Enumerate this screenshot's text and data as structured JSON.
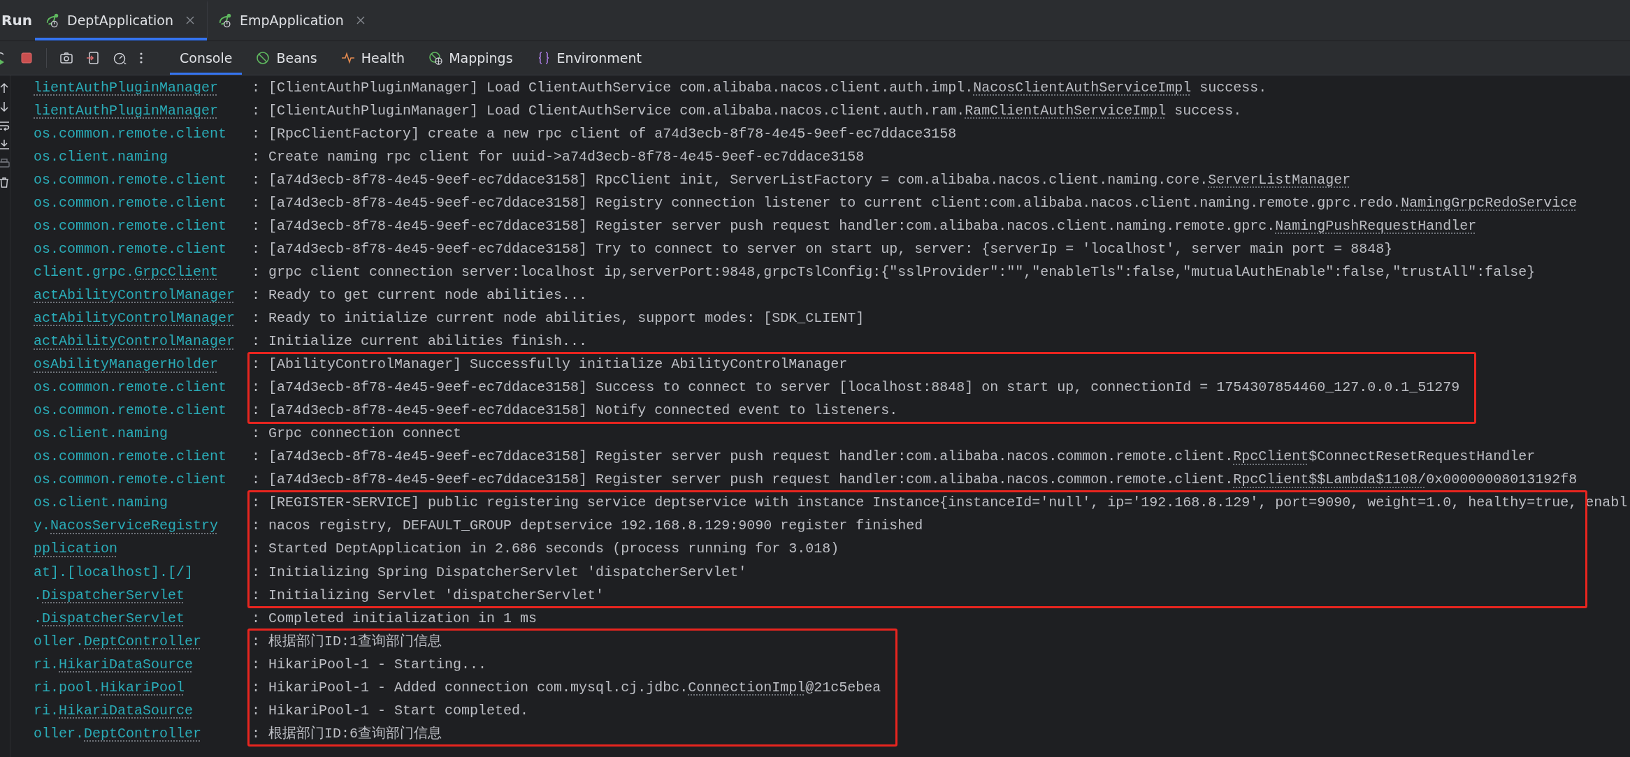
{
  "tool_window": {
    "title": "Run"
  },
  "run_tabs": [
    {
      "label": "DeptApplication",
      "selected": true
    },
    {
      "label": "EmpApplication",
      "selected": false
    }
  ],
  "view_tabs": [
    {
      "label": "Console",
      "selected": true,
      "kind": "console"
    },
    {
      "label": "Beans",
      "selected": false,
      "kind": "beans"
    },
    {
      "label": "Health",
      "selected": false,
      "kind": "health"
    },
    {
      "label": "Mappings",
      "selected": false,
      "kind": "mappings"
    },
    {
      "label": "Environment",
      "selected": false,
      "kind": "environment"
    }
  ],
  "log": {
    "separator": ":",
    "groups": [
      {
        "highlighted": false,
        "lines": [
          {
            "logger": [
              {
                "link": "lientAuthPluginManager"
              }
            ],
            "message": [
              "[ClientAuthPluginManager] Load ClientAuthService com.alibaba.nacos.client.auth.impl.",
              {
                "link": "NacosClientAuthServiceImpl"
              },
              " success."
            ]
          },
          {
            "logger": [
              {
                "link": "lientAuthPluginManager"
              }
            ],
            "message": [
              "[ClientAuthPluginManager] Load ClientAuthService com.alibaba.nacos.client.auth.ram.",
              {
                "link": "RamClientAuthServiceImpl"
              },
              " success."
            ]
          },
          {
            "logger": [
              "os.common.remote.client"
            ],
            "message": [
              "[RpcClientFactory] create a new rpc client of a74d3ecb-8f78-4e45-9eef-ec7ddace3158"
            ]
          },
          {
            "logger": [
              "os.client.naming"
            ],
            "message": [
              "Create naming rpc client for uuid->a74d3ecb-8f78-4e45-9eef-ec7ddace3158"
            ]
          },
          {
            "logger": [
              "os.common.remote.client"
            ],
            "message": [
              "[a74d3ecb-8f78-4e45-9eef-ec7ddace3158] RpcClient init, ServerListFactory = com.alibaba.nacos.client.naming.core.",
              {
                "link": "ServerListManager"
              }
            ]
          },
          {
            "logger": [
              "os.common.remote.client"
            ],
            "message": [
              "[a74d3ecb-8f78-4e45-9eef-ec7ddace3158] Registry connection listener to current client:com.alibaba.nacos.client.naming.remote.gprc.redo.",
              {
                "link": "NamingGrpcRedoService"
              }
            ]
          },
          {
            "logger": [
              "os.common.remote.client"
            ],
            "message": [
              "[a74d3ecb-8f78-4e45-9eef-ec7ddace3158] Register server push request handler:com.alibaba.nacos.client.naming.remote.gprc.",
              {
                "link": "NamingPushRequestHandler"
              }
            ]
          },
          {
            "logger": [
              "os.common.remote.client"
            ],
            "message": [
              "[a74d3ecb-8f78-4e45-9eef-ec7ddace3158] Try to connect to server on start up, server: {serverIp = 'localhost', server main port = 8848}"
            ]
          },
          {
            "logger": [
              "client.grpc.",
              {
                "link": "GrpcClient"
              }
            ],
            "message": [
              "grpc client connection server:localhost ip,serverPort:9848,grpcTslConfig:{\"sslProvider\":\"\",\"enableTls\":false,\"mutualAuthEnable\":false,\"trustAll\":false}"
            ]
          },
          {
            "logger": [
              {
                "link": "actAbilityControlManager"
              }
            ],
            "message": [
              "Ready to get current node abilities..."
            ]
          },
          {
            "logger": [
              {
                "link": "actAbilityControlManager"
              }
            ],
            "message": [
              "Ready to initialize current node abilities, support modes: [SDK_CLIENT]"
            ]
          },
          {
            "logger": [
              {
                "link": "actAbilityControlManager"
              }
            ],
            "message": [
              "Initialize current abilities finish..."
            ]
          }
        ]
      },
      {
        "highlighted": true,
        "lines": [
          {
            "logger": [
              {
                "link": "osAbilityManagerHolder"
              }
            ],
            "message": [
              "[AbilityControlManager] Successfully initialize AbilityControlManager"
            ]
          },
          {
            "logger": [
              "os.common.remote.client"
            ],
            "message": [
              "[a74d3ecb-8f78-4e45-9eef-ec7ddace3158] Success to connect to server [localhost:8848] on start up, connectionId = 1754307854460_127.0.0.1_51279"
            ]
          },
          {
            "logger": [
              "os.common.remote.client"
            ],
            "message": [
              "[a74d3ecb-8f78-4e45-9eef-ec7ddace3158] Notify connected event to listeners."
            ]
          }
        ]
      },
      {
        "highlighted": false,
        "lines": [
          {
            "logger": [
              "os.client.naming"
            ],
            "message": [
              "Grpc connection connect"
            ]
          },
          {
            "logger": [
              "os.common.remote.client"
            ],
            "message": [
              "[a74d3ecb-8f78-4e45-9eef-ec7ddace3158] Register server push request handler:com.alibaba.nacos.common.remote.client.",
              {
                "link": "RpcClient"
              },
              "$ConnectResetRequestHandler"
            ]
          },
          {
            "logger": [
              "os.common.remote.client"
            ],
            "message": [
              "[a74d3ecb-8f78-4e45-9eef-ec7ddace3158] Register server push request handler:com.alibaba.nacos.common.remote.client.",
              {
                "link": "RpcClient$$Lambda$1108/"
              },
              "0x00000008013192f8"
            ]
          }
        ]
      },
      {
        "highlighted": true,
        "lines": [
          {
            "logger": [
              "os.client.naming"
            ],
            "message": [
              "[REGISTER-SERVICE] public registering service deptservice with instance Instance{instanceId='null', ip='192.168.8.129', port=9090, weight=1.0, healthy=true, enabl"
            ]
          },
          {
            "logger": [
              "y.",
              {
                "link": "NacosServiceRegistry"
              }
            ],
            "message": [
              "nacos registry, DEFAULT_GROUP deptservice 192.168.8.129:9090 register finished"
            ]
          },
          {
            "logger": [
              {
                "link": "pplication"
              }
            ],
            "message": [
              "Started DeptApplication in 2.686 seconds (process running for 3.018)"
            ]
          },
          {
            "logger": [
              "at].[localhost].[/]"
            ],
            "message": [
              "Initializing Spring DispatcherServlet 'dispatcherServlet'"
            ]
          },
          {
            "logger": [
              ".",
              {
                "link": "DispatcherServlet"
              }
            ],
            "message": [
              "Initializing Servlet 'dispatcherServlet'"
            ]
          }
        ]
      },
      {
        "highlighted": false,
        "lines": [
          {
            "logger": [
              ".",
              {
                "link": "DispatcherServlet"
              }
            ],
            "message": [
              "Completed initialization in 1 ms"
            ]
          }
        ]
      },
      {
        "highlighted": true,
        "lines": [
          {
            "logger": [
              "oller.",
              {
                "link": "DeptController"
              }
            ],
            "message": [
              "根据部门ID:1查询部门信息"
            ]
          },
          {
            "logger": [
              "ri.",
              {
                "link": "HikariDataSource"
              }
            ],
            "message": [
              "HikariPool-1 - Starting..."
            ]
          },
          {
            "logger": [
              "ri.pool.",
              {
                "link": "HikariPool"
              }
            ],
            "message": [
              "HikariPool-1 - Added connection com.mysql.cj.jdbc.",
              {
                "link": "ConnectionImpl"
              },
              "@21c5ebea"
            ]
          },
          {
            "logger": [
              "ri.",
              {
                "link": "HikariDataSource"
              }
            ],
            "message": [
              "HikariPool-1 - Start completed."
            ]
          },
          {
            "logger": [
              "oller.",
              {
                "link": "DeptController"
              }
            ],
            "message": [
              "根据部门ID:6查询部门信息"
            ]
          }
        ]
      }
    ]
  }
}
